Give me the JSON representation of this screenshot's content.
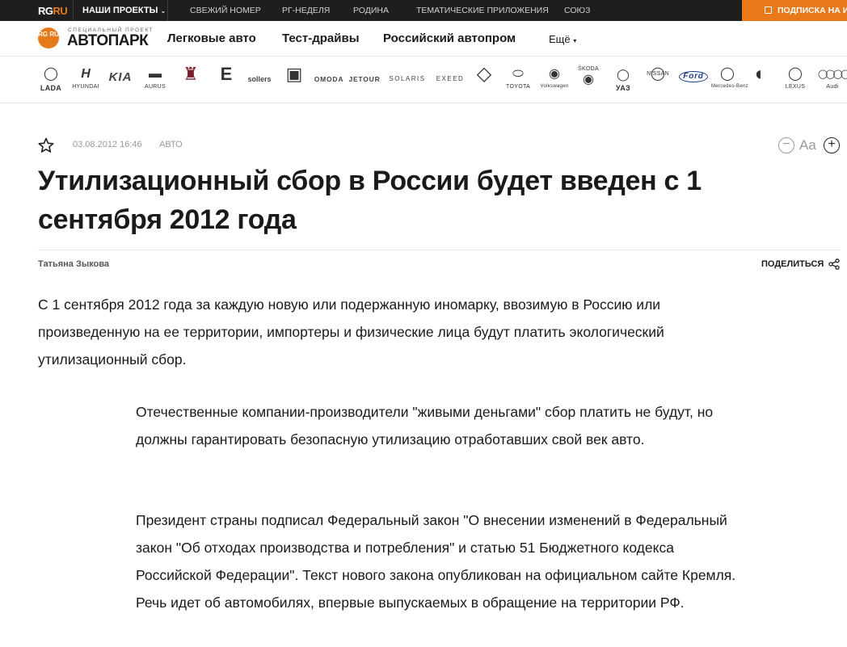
{
  "topbar": {
    "logo_rg": "RG",
    "logo_ru": "RU",
    "projects": "НАШИ ПРОЕКТЫ",
    "links": [
      "СВЕЖИЙ НОМЕР",
      "РГ-НЕДЕЛЯ",
      "РОДИНА",
      "ТЕМАТИЧЕСКИЕ ПРИЛОЖЕНИЯ",
      "СОЮЗ"
    ],
    "subscribe": "ПОДПИСКА НА ИЗДАНИЕ"
  },
  "project": {
    "badge": "RG RU",
    "small": "специальный проект",
    "name": "АВТОПАРК",
    "nav": [
      "Легковые авто",
      "Тест-драйвы",
      "Российский автопром"
    ],
    "more": "Ещё"
  },
  "brands": {
    "lada": "LADA",
    "hyundai": "HYUNDAI",
    "kia": "KIA",
    "aurus": "AURUS",
    "sollers": "sollers",
    "omoda": "OMODA",
    "jetour": "JETOUR",
    "solaris": "SOLARIS",
    "exeed": "EXEED",
    "toyota": "TOYOTA",
    "volkswagen": "Volkswagen",
    "skoda": "ŠKODA",
    "uaz": "УАЗ",
    "nissan": "NISSAN",
    "ford": "Ford",
    "mercedes": "Mercedes-Benz",
    "lexus": "LEXUS",
    "audi": "Audi"
  },
  "article": {
    "date": "03.08.2012 16:46",
    "rubric": "АВТО",
    "font_label": "Aa",
    "title": "Утилизационный сбор в России будет введен с 1 сентября 2012 года",
    "author": "Татьяна Зыкова",
    "share": "ПОДЕЛИТЬСЯ",
    "lead": "С 1 сентября 2012 года за каждую новую или подержанную иномарку, ввозимую в Россию или произведенную на ее территории, импортеры и физические лица будут платить экологический утилизационный сбор.",
    "paragraphs": [
      "Отечественные компании-производители \"живыми деньгами\" сбор платить не будут, но должны гарантировать безопасную утилизацию отработавших свой век авто.",
      "Президент страны подписал Федеральный закон \"О внесении изменений в Федеральный закон \"Об отходах производства и потребления\" и статью 51 Бюджетного кодекса Российской Федерации\". Текст нового закона опубликован на официальном сайте Кремля. Речь идет об автомобилях, впервые выпускаемых в обращение на территории РФ."
    ]
  },
  "colors": {
    "accent": "#e8791a",
    "topbar": "#1e1e1e"
  }
}
